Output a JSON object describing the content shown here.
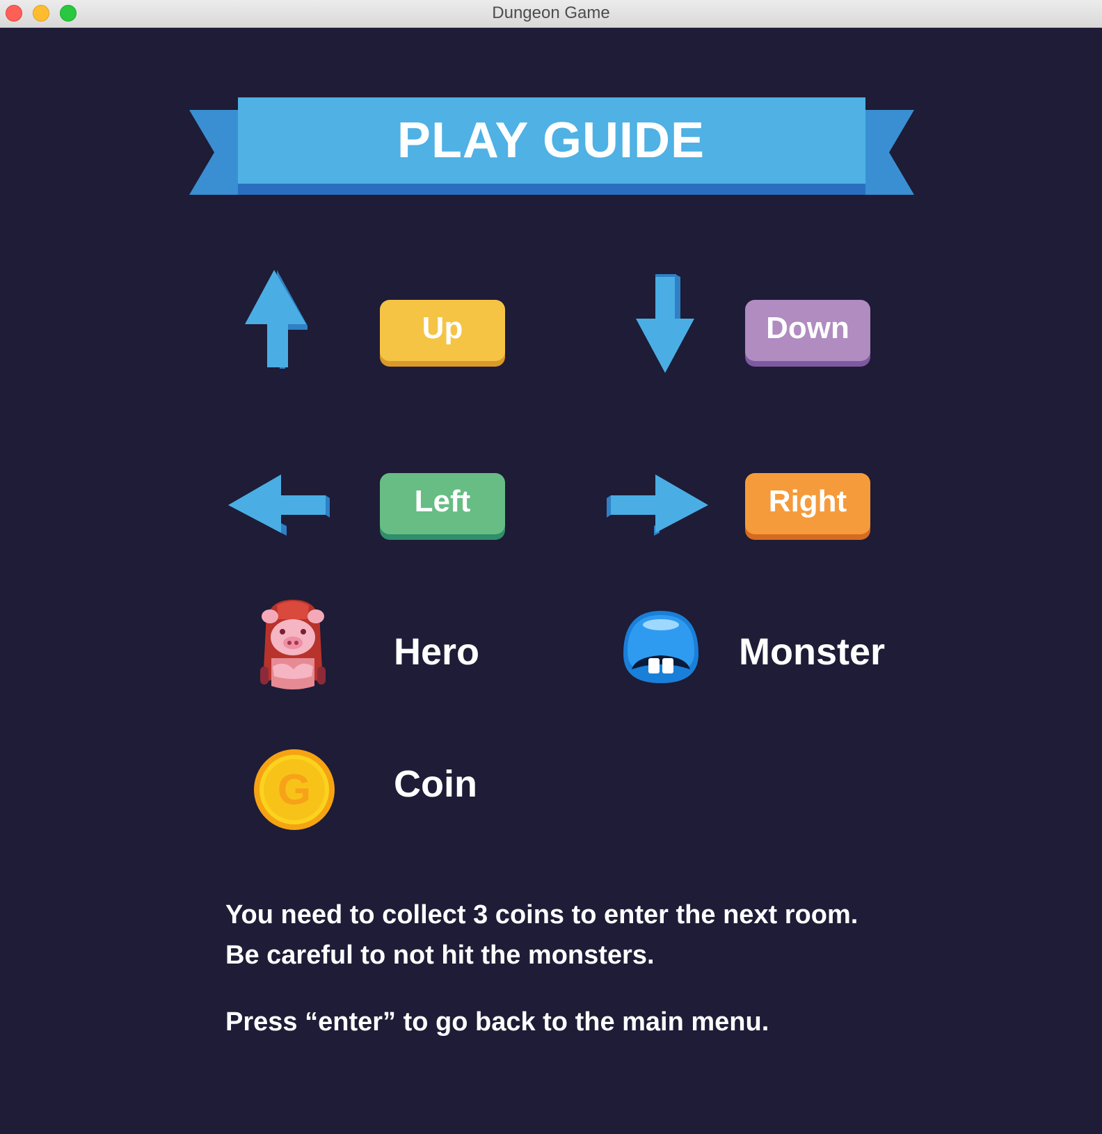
{
  "window": {
    "title": "Dungeon Game"
  },
  "banner": {
    "title": "PLAY GUIDE"
  },
  "controls": {
    "up": "Up",
    "down": "Down",
    "left": "Left",
    "right": "Right"
  },
  "legend": {
    "hero": "Hero",
    "monster": "Monster",
    "coin": "Coin",
    "coin_letter": "G"
  },
  "instructions": {
    "line1": "You need to collect 3 coins to enter the next room.",
    "line2": "Be careful to not hit the monsters.",
    "line3": "Press “enter” to go back to the main menu."
  },
  "colors": {
    "background": "#1e1c36",
    "banner": "#4fb1e4",
    "arrow": "#4aaee5",
    "up_key": "#f5c445",
    "down_key": "#b08cc0",
    "left_key": "#67bd84",
    "right_key": "#f59b3b"
  }
}
